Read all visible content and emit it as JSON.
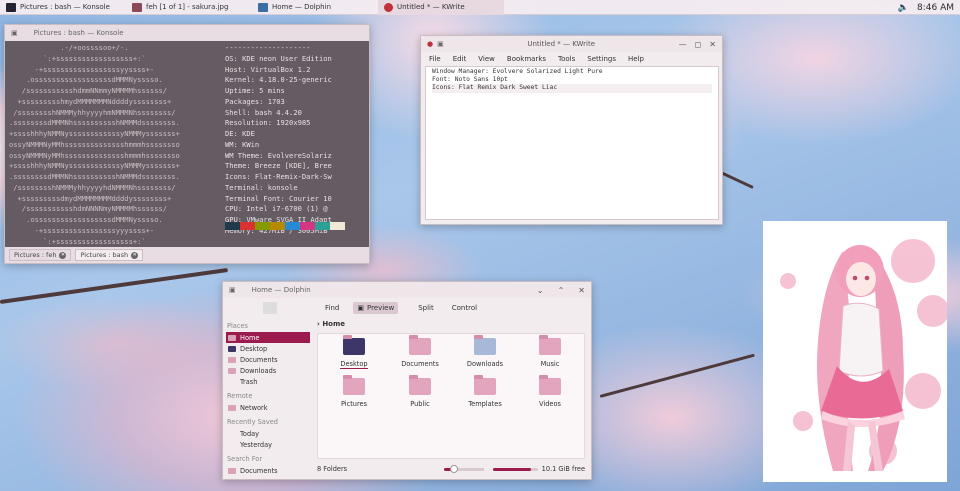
{
  "taskbar": {
    "tasks": [
      {
        "label": "Pictures : bash — Konsole",
        "icon": "konsole-icon"
      },
      {
        "label": "feh [1 of 1] - sakura.jpg",
        "icon": "feh-icon"
      },
      {
        "label": "Home — Dolphin",
        "icon": "dolphin-icon"
      },
      {
        "label": "Untitled * — KWrite",
        "icon": "kwrite-icon"
      }
    ],
    "clock": "8:46 AM",
    "volume_icon": "speaker-icon"
  },
  "konsole": {
    "title": "Pictures : bash — Konsole",
    "art_lines": [
      "            .-/+oossssoo+/-.",
      "        `:+ssssssssssssssssss+:`",
      "      -+ssssssssssssssssssyyssss+-",
      "    .ossssssssssssssssssdMMMNysssso.",
      "   /ssssssssssshdmmNNmmyNMMMMhssssss/",
      "  +ssssssssshmydMMMMMMMNddddyssssssss+",
      " /sssssssshNMMMyhhyyyyhmNMMMNhssssssss/",
      ".ssssssssdMMMNhsssssssssshNMMMdssssssss.",
      "+sssshhhyNMMNyssssssssssssyNMMMysssssss+",
      "ossyNMMMNyMMhsssssssssssssshmmmhssssssso",
      "ossyNMMMNyMMhsssssssssssssshmmmhssssssso",
      "+sssshhhyNMMNyssssssssssssyNMMMysssssss+",
      ".ssssssssdMMMNhsssssssssshNMMMdssssssss.",
      " /sssssssshNMMMyhhyyyyhdNMMMNhssssssss/",
      "  +sssssssssdmydMMMMMMMMddddyssssssss+",
      "   /ssssssssssshdmNNNNmyNMMMMhssssss/",
      "    .ossssssssssssssssssdMMMNysssso.",
      "      -+sssssssssssssssssyyyssss+-",
      "        `:+ssssssssssssssssss+:`",
      "            .-/+oossssoo+/-."
    ],
    "info_lines": [
      "--------------------",
      "OS: KDE neon User Edition",
      "Host: VirtualBox 1.2",
      "Kernel: 4.18.0-25-generic",
      "Uptime: 5 mins",
      "Packages: 1703",
      "Shell: bash 4.4.20",
      "Resolution: 1920x985",
      "DE: KDE",
      "WM: KWin",
      "WM Theme: EvolvereSolariz",
      "Theme: Breeze [KDE], Bree",
      "Icons: Flat-Remix-Dark-Sw",
      "Terminal: konsole",
      "Terminal Font: Courier 10",
      "CPU: Intel i7-6700 (1) @",
      "GPU: VMware SVGA II Adapt",
      "Memory: 427MiB / 3005MiB"
    ],
    "swatches": [
      "#1f3a4a",
      "#dc322f",
      "#859900",
      "#b58900",
      "#268bd2",
      "#d33682",
      "#2aa198",
      "#eee8d5"
    ],
    "tabs": [
      "Pictures : feh",
      "Pictures : bash"
    ]
  },
  "kwrite": {
    "title": "Untitled * — KWrite",
    "menu": [
      "File",
      "Edit",
      "View",
      "Bookmarks",
      "Tools",
      "Settings",
      "Help"
    ],
    "lines": [
      "Window Manager: Evolvere Solarized Light Pure",
      "Font: Noto Sans 10pt",
      "Icons: Flat Remix Dark Sweet Liac"
    ]
  },
  "dolphin": {
    "title": "Home — Dolphin",
    "toolbar": {
      "find": "Find",
      "preview": "Preview",
      "split": "Split",
      "control": "Control"
    },
    "breadcrumb": "Home",
    "places_header": "Places",
    "places": [
      "Home",
      "Desktop",
      "Documents",
      "Downloads",
      "Trash"
    ],
    "remote_header": "Remote",
    "remote": [
      "Network"
    ],
    "recent_header": "Recently Saved",
    "recent": [
      "Today",
      "Yesterday"
    ],
    "search_header": "Search For",
    "search": [
      "Documents"
    ],
    "files": [
      "Desktop",
      "Documents",
      "Downloads",
      "Music",
      "Pictures",
      "Public",
      "Templates",
      "Videos"
    ],
    "status_count": "8 Folders",
    "zoom_fraction": 0.25,
    "disk_used_fraction": 0.85,
    "free_space": "10.1 GiB free"
  },
  "colors": {
    "accent": "#9c1b4f",
    "terminal_bg": "#655b63"
  }
}
